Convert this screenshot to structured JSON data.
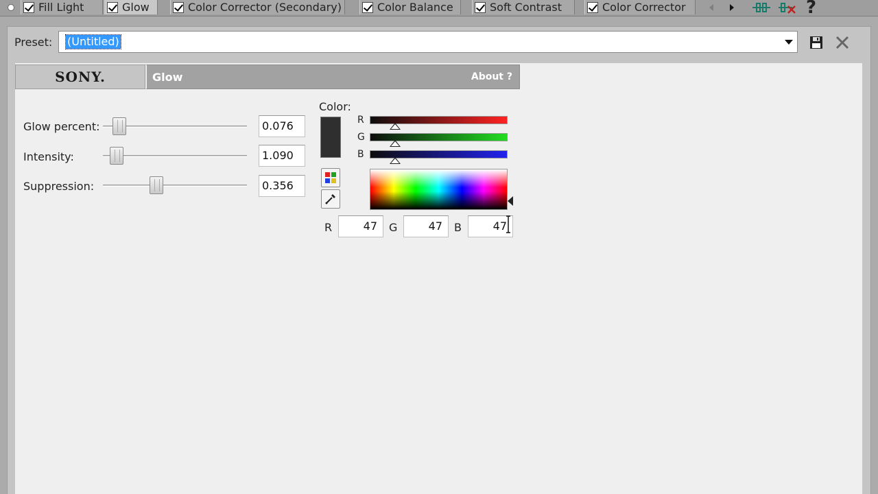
{
  "chain": {
    "tabs": [
      {
        "label": "Fill Light",
        "checked": true
      },
      {
        "label": "Glow",
        "checked": true,
        "active": true
      },
      {
        "label": "Color Corrector (Secondary)",
        "checked": true
      },
      {
        "label": "Color Balance",
        "checked": true
      },
      {
        "label": "Soft Contrast",
        "checked": true
      },
      {
        "label": "Color Corrector",
        "checked": true
      }
    ],
    "help": "?"
  },
  "preset": {
    "label": "Preset:",
    "value": "(Untitled)"
  },
  "plugin": {
    "brand": "SONY.",
    "name": "Glow",
    "about": "About  ?"
  },
  "params": [
    {
      "label": "Glow percent:",
      "value": "0.076",
      "slider": 0.076
    },
    {
      "label": "Intensity:",
      "value": "1.090",
      "slider": 0.05
    },
    {
      "label": "Suppression:",
      "value": "0.356",
      "slider": 0.356
    }
  ],
  "color": {
    "label": "Color:",
    "swatch": "#2f2f2f",
    "channels": [
      {
        "name": "R",
        "gradient_end": "#ff2222",
        "level": 0.184
      },
      {
        "name": "G",
        "gradient_end": "#22dd22",
        "level": 0.184
      },
      {
        "name": "B",
        "gradient_end": "#2222ee",
        "level": 0.184
      }
    ],
    "fields": [
      {
        "label": "R",
        "value": "47"
      },
      {
        "label": "G",
        "value": "47"
      },
      {
        "label": "B",
        "value": "47"
      }
    ]
  }
}
